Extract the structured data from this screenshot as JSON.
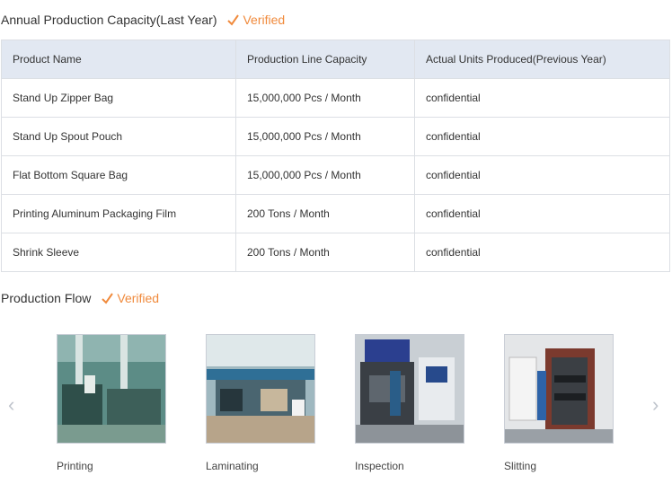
{
  "capacity": {
    "title": "Annual Production Capacity(Last Year)",
    "verified": "Verified",
    "headers": [
      "Product Name",
      "Production Line Capacity",
      "Actual Units Produced(Previous Year)"
    ],
    "rows": [
      [
        "Stand Up Zipper Bag",
        "15,000,000 Pcs / Month",
        "confidential"
      ],
      [
        "Stand Up Spout Pouch",
        "15,000,000 Pcs / Month",
        "confidential"
      ],
      [
        "Flat Bottom Square Bag",
        "15,000,000 Pcs / Month",
        "confidential"
      ],
      [
        "Printing Aluminum Packaging Film",
        "200 Tons / Month",
        "confidential"
      ],
      [
        "Shrink Sleeve",
        "200 Tons / Month",
        "confidential"
      ]
    ]
  },
  "flow": {
    "title": "Production Flow",
    "verified": "Verified",
    "items": [
      {
        "label": "Printing"
      },
      {
        "label": "Laminating"
      },
      {
        "label": "Inspection"
      },
      {
        "label": "Slitting"
      }
    ],
    "prev_icon": "chevron-left-icon",
    "next_icon": "chevron-right-icon"
  },
  "colors": {
    "verified": "#f08a3c",
    "header_bg": "#e2e8f2",
    "border": "#dcdfe4"
  }
}
